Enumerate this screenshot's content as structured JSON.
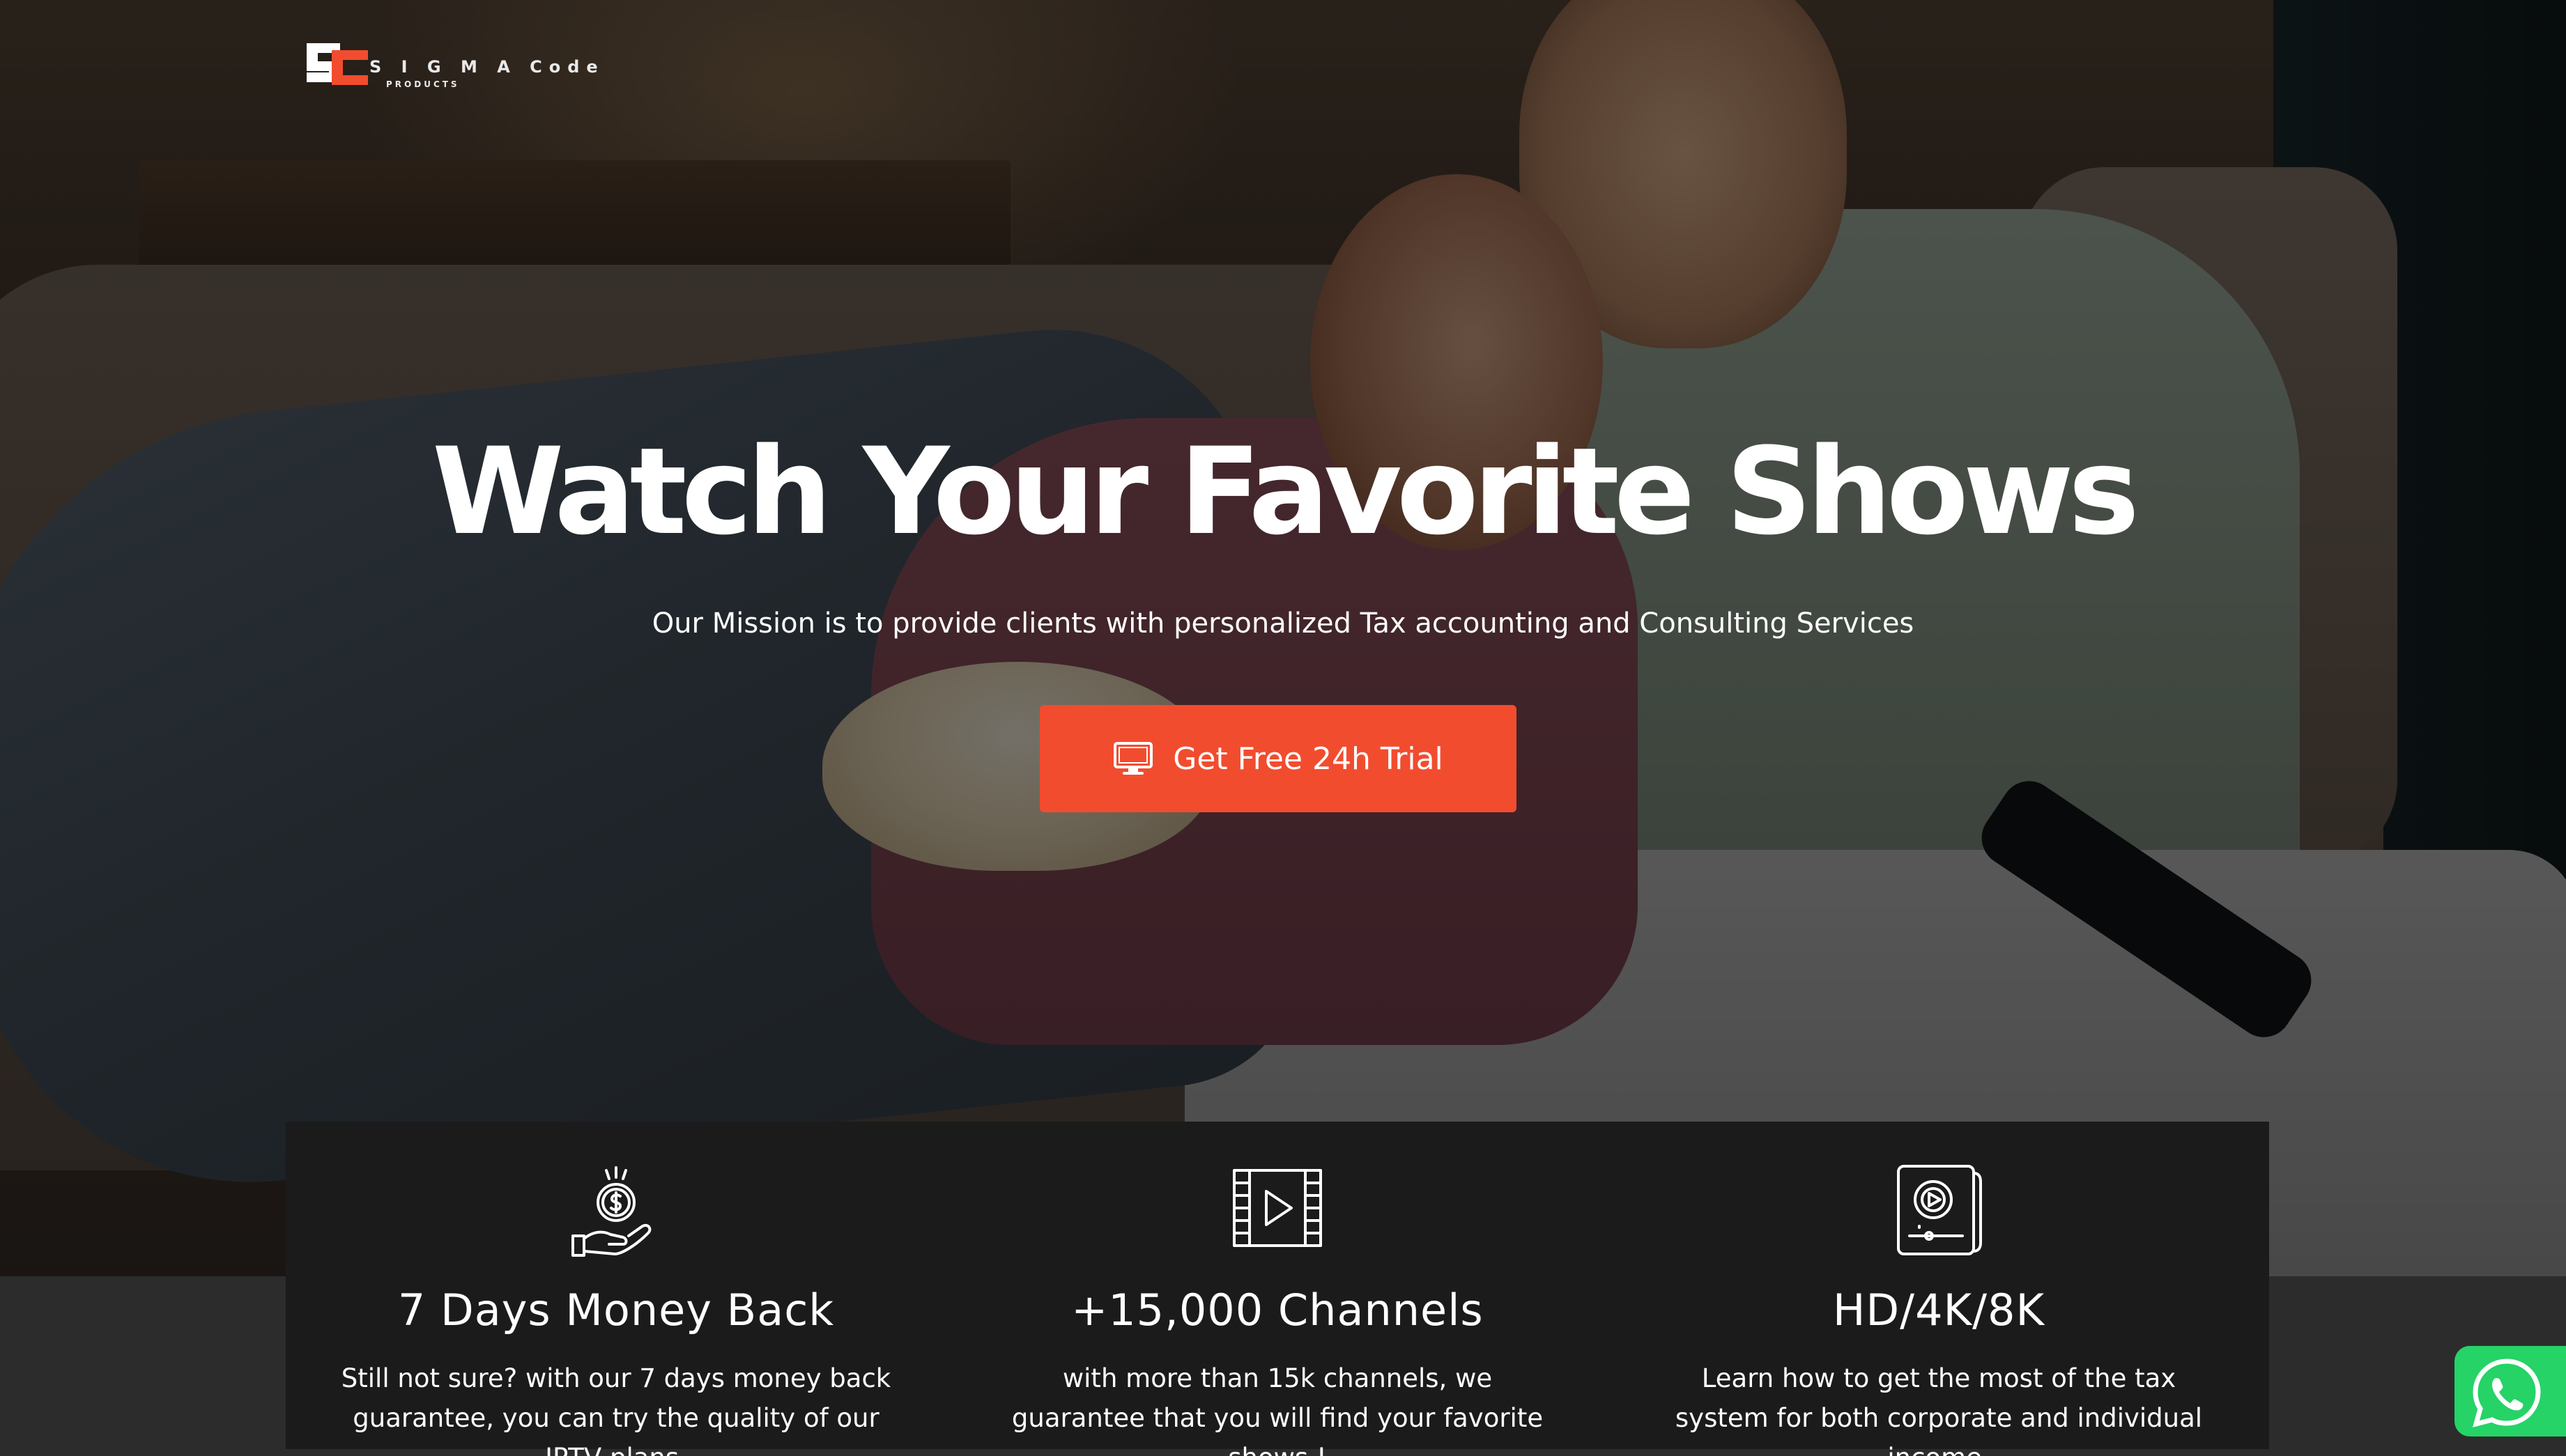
{
  "brand": {
    "logo_letters": "SC",
    "name": "S I G M A  Code",
    "tagline": "PRODUCTS",
    "accent_color": "#f24c2f"
  },
  "hero": {
    "title": "Watch Your Favorite Shows",
    "subtitle": "Our Mission is to provide clients with personalized Tax accounting and Consulting Services",
    "cta_label": "Get Free 24h Trial",
    "cta_icon": "monitor-icon",
    "background": "couple-watching-tv-photo"
  },
  "features": [
    {
      "icon": "money-back-hand-icon",
      "title": "7 Days Money Back",
      "description": "Still not sure? with our 7 days money back guarantee, you can try the quality of our IPTV plans."
    },
    {
      "icon": "film-play-icon",
      "title": "+15,000 Channels",
      "description": "with more than 15k channels, we guarantee that you will find your favorite shows !"
    },
    {
      "icon": "video-player-icon",
      "title": "HD/4K/8K",
      "description": "Learn how to get the most of the tax system for both corporate and individual income."
    }
  ],
  "whatsapp": {
    "icon": "whatsapp-icon",
    "color": "#25d366"
  }
}
